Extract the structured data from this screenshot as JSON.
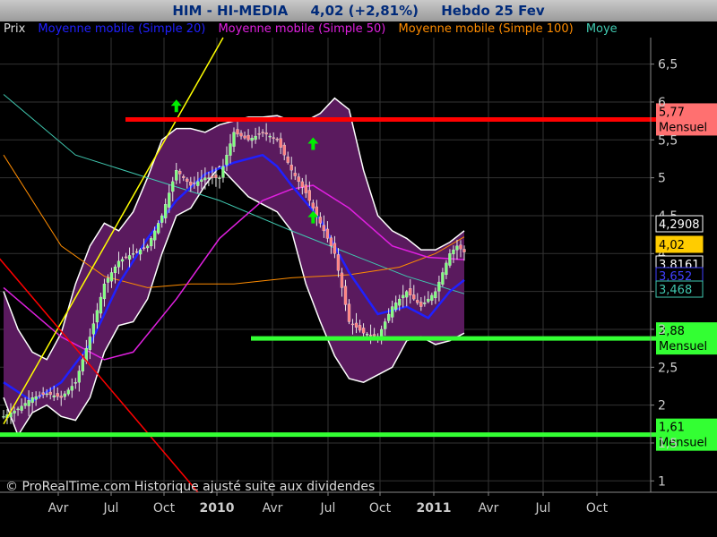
{
  "header": {
    "symbol": "HIM - HI-MEDIA",
    "quote": "4,02 (+2,81%)",
    "period": "Hebdo  25 Fev"
  },
  "legend": {
    "price": "Prix",
    "ma20": "Moyenne mobile (Simple 20)",
    "ma50": "Moyenne mobile (Simple 50)",
    "ma100": "Moyenne mobile (Simple 100)",
    "ma200": "Moye"
  },
  "footer": {
    "copyright": "© ProRealTime.com Historique ajusté suite aux dividendes"
  },
  "colors": {
    "ma20": "#2020ff",
    "ma50": "#e020e0",
    "ma100": "#ff8c00",
    "ma200": "#40c8b0",
    "band_fill": "#5a1a5e",
    "candle_up": "#80ff80",
    "candle_down": "#ff8080",
    "resistance": "#ff0000",
    "support": "#33ff33",
    "uptrend": "#ffff00"
  },
  "chart_data": {
    "type": "candlestick",
    "ylim": [
      0.85,
      6.85
    ],
    "y_ticks": [
      "1",
      "1,5",
      "2",
      "2,5",
      "3",
      "3,5",
      "4",
      "4,5",
      "5",
      "5,5",
      "6",
      "6,5"
    ],
    "x_ticks": [
      {
        "label": "Avr",
        "bold": false
      },
      {
        "label": "Jul",
        "bold": false
      },
      {
        "label": "Oct",
        "bold": false
      },
      {
        "label": "2010",
        "bold": true
      },
      {
        "label": "Avr",
        "bold": false
      },
      {
        "label": "Jul",
        "bold": false
      },
      {
        "label": "Oct",
        "bold": false
      },
      {
        "label": "2011",
        "bold": true
      },
      {
        "label": "Avr",
        "bold": false
      },
      {
        "label": "Jul",
        "bold": false
      },
      {
        "label": "Oct",
        "bold": false
      }
    ],
    "close_path": [
      [
        0,
        1.85
      ],
      [
        4,
        1.95
      ],
      [
        8,
        2.1
      ],
      [
        12,
        2.15
      ],
      [
        16,
        2.1
      ],
      [
        20,
        2.3
      ],
      [
        24,
        2.9
      ],
      [
        28,
        3.6
      ],
      [
        32,
        3.9
      ],
      [
        36,
        4.0
      ],
      [
        40,
        4.1
      ],
      [
        44,
        4.5
      ],
      [
        48,
        5.1
      ],
      [
        52,
        4.9
      ],
      [
        56,
        5.0
      ],
      [
        60,
        5.0
      ],
      [
        64,
        5.6
      ],
      [
        68,
        5.5
      ],
      [
        72,
        5.6
      ],
      [
        76,
        5.5
      ],
      [
        80,
        5.1
      ],
      [
        84,
        4.8
      ],
      [
        88,
        4.4
      ],
      [
        92,
        4.0
      ],
      [
        96,
        3.1
      ],
      [
        100,
        2.95
      ],
      [
        104,
        2.9
      ],
      [
        108,
        3.3
      ],
      [
        112,
        3.5
      ],
      [
        116,
        3.3
      ],
      [
        120,
        3.5
      ],
      [
        124,
        4.0
      ],
      [
        126,
        4.1
      ],
      [
        128,
        4.02
      ]
    ],
    "ma20_path": [
      [
        0,
        2.3
      ],
      [
        8,
        2.05
      ],
      [
        16,
        2.3
      ],
      [
        24,
        2.8
      ],
      [
        32,
        3.6
      ],
      [
        40,
        4.2
      ],
      [
        48,
        4.7
      ],
      [
        56,
        5.05
      ],
      [
        64,
        5.2
      ],
      [
        72,
        5.3
      ],
      [
        76,
        5.15
      ],
      [
        80,
        4.9
      ],
      [
        88,
        4.45
      ],
      [
        96,
        3.75
      ],
      [
        104,
        3.2
      ],
      [
        112,
        3.3
      ],
      [
        118,
        3.15
      ],
      [
        124,
        3.5
      ],
      [
        128,
        3.65
      ]
    ],
    "ma50_path": [
      [
        0,
        3.55
      ],
      [
        16,
        2.9
      ],
      [
        28,
        2.6
      ],
      [
        36,
        2.7
      ],
      [
        48,
        3.4
      ],
      [
        60,
        4.2
      ],
      [
        72,
        4.7
      ],
      [
        80,
        4.85
      ],
      [
        86,
        4.9
      ],
      [
        96,
        4.6
      ],
      [
        108,
        4.1
      ],
      [
        118,
        3.95
      ],
      [
        128,
        3.92
      ]
    ],
    "ma100_path": [
      [
        0,
        5.3
      ],
      [
        16,
        4.1
      ],
      [
        28,
        3.7
      ],
      [
        40,
        3.55
      ],
      [
        52,
        3.6
      ],
      [
        64,
        3.6
      ],
      [
        80,
        3.68
      ],
      [
        96,
        3.72
      ],
      [
        110,
        3.82
      ],
      [
        120,
        4.0
      ],
      [
        128,
        4.22
      ]
    ],
    "ma200_path": [
      [
        0,
        6.1
      ],
      [
        20,
        5.3
      ],
      [
        40,
        5.0
      ],
      [
        60,
        4.7
      ],
      [
        80,
        4.3
      ],
      [
        96,
        4.0
      ],
      [
        112,
        3.7
      ],
      [
        128,
        3.47
      ]
    ],
    "band_upper_path": [
      [
        0,
        3.5
      ],
      [
        4,
        3.0
      ],
      [
        8,
        2.7
      ],
      [
        12,
        2.6
      ],
      [
        16,
        2.95
      ],
      [
        20,
        3.6
      ],
      [
        24,
        4.1
      ],
      [
        28,
        4.4
      ],
      [
        32,
        4.3
      ],
      [
        36,
        4.55
      ],
      [
        40,
        5.0
      ],
      [
        44,
        5.5
      ],
      [
        48,
        5.65
      ],
      [
        52,
        5.65
      ],
      [
        56,
        5.6
      ],
      [
        60,
        5.7
      ],
      [
        64,
        5.75
      ],
      [
        68,
        5.8
      ],
      [
        72,
        5.8
      ],
      [
        76,
        5.82
      ],
      [
        80,
        5.75
      ],
      [
        84,
        5.75
      ],
      [
        88,
        5.85
      ],
      [
        92,
        6.05
      ],
      [
        96,
        5.9
      ],
      [
        100,
        5.1
      ],
      [
        104,
        4.5
      ],
      [
        108,
        4.3
      ],
      [
        112,
        4.2
      ],
      [
        116,
        4.05
      ],
      [
        120,
        4.05
      ],
      [
        124,
        4.15
      ],
      [
        128,
        4.3
      ]
    ],
    "band_lower_path": [
      [
        0,
        2.1
      ],
      [
        4,
        1.6
      ],
      [
        8,
        1.9
      ],
      [
        12,
        2.0
      ],
      [
        16,
        1.85
      ],
      [
        20,
        1.8
      ],
      [
        24,
        2.1
      ],
      [
        28,
        2.7
      ],
      [
        32,
        3.05
      ],
      [
        36,
        3.1
      ],
      [
        40,
        3.4
      ],
      [
        44,
        4.0
      ],
      [
        48,
        4.5
      ],
      [
        52,
        4.6
      ],
      [
        56,
        4.9
      ],
      [
        60,
        5.15
      ],
      [
        64,
        4.95
      ],
      [
        68,
        4.75
      ],
      [
        72,
        4.65
      ],
      [
        76,
        4.55
      ],
      [
        80,
        4.3
      ],
      [
        84,
        3.6
      ],
      [
        88,
        3.1
      ],
      [
        92,
        2.65
      ],
      [
        96,
        2.35
      ],
      [
        100,
        2.3
      ],
      [
        104,
        2.4
      ],
      [
        108,
        2.5
      ],
      [
        112,
        2.85
      ],
      [
        116,
        2.9
      ],
      [
        120,
        2.8
      ],
      [
        124,
        2.85
      ],
      [
        128,
        2.95
      ]
    ],
    "horizontal_lines": [
      {
        "value": 5.77,
        "label": "5,77",
        "sublabel": "Mensuel",
        "color": "#ff0000",
        "x_start": 140,
        "thickness": 5
      },
      {
        "value": 2.88,
        "label": "2,88",
        "sublabel": "Mensuel",
        "color": "#33ff33",
        "x_start": 280,
        "thickness": 5
      },
      {
        "value": 1.61,
        "label": "1,61",
        "sublabel": "Mensuel",
        "color": "#33ff33",
        "x_start": 0,
        "thickness": 5
      }
    ],
    "trend_lines": [
      {
        "name": "uptrend",
        "from": [
          0,
          1.75
        ],
        "to": [
          61,
          6.85
        ],
        "color": "#ffff00"
      },
      {
        "name": "downtrend",
        "from": [
          -5,
          4.15
        ],
        "to": [
          54,
          0.85
        ],
        "color": "#ff0000"
      }
    ],
    "arrows": [
      {
        "x": 48,
        "y": 5.95
      },
      {
        "x": 86,
        "y": 5.45
      },
      {
        "x": 86,
        "y": 4.48
      }
    ],
    "price_tags": [
      {
        "value": 4.2908,
        "label": "4,2908",
        "bg": "#000000",
        "fg": "#ffffff",
        "border": "#ffffff"
      },
      {
        "value": 4.02,
        "label": "4,02",
        "bg": "#ffcc00",
        "fg": "#000000",
        "border": "#ffcc00"
      },
      {
        "value": 3.8161,
        "label": "3,8161",
        "bg": "#000000",
        "fg": "#ffffff",
        "border": "#ffffff"
      },
      {
        "value": 3.652,
        "label": "3,652",
        "bg": "#000000",
        "fg": "#4040ff",
        "border": "#4040ff"
      },
      {
        "value": 3.468,
        "label": "3,468",
        "bg": "#000000",
        "fg": "#40c8b0",
        "border": "#40c8b0"
      }
    ],
    "grid": true
  }
}
